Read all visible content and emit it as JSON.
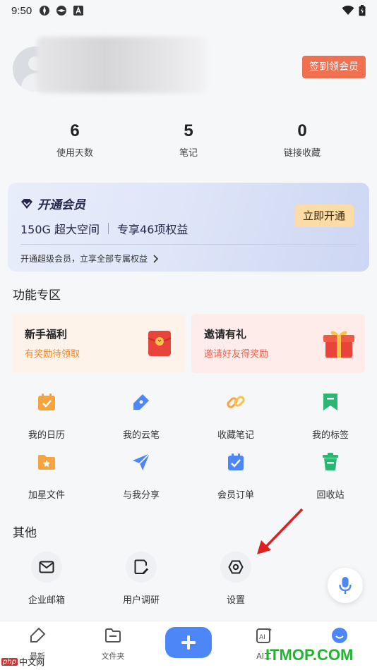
{
  "status_bar": {
    "time": "9:50"
  },
  "profile": {
    "signin_button": "签到领会员"
  },
  "stats": [
    {
      "value": "6",
      "label": "使用天数"
    },
    {
      "value": "5",
      "label": "笔记"
    },
    {
      "value": "0",
      "label": "链接收藏"
    }
  ],
  "vip": {
    "title": "开通会员",
    "storage": "150G 超大空间",
    "benefits": "专享46项权益",
    "button": "立即开通",
    "footer": "开通超级会员，立享全部专属权益"
  },
  "features": {
    "title": "功能专区",
    "promos": [
      {
        "title": "新手福利",
        "subtitle": "有奖励待领取"
      },
      {
        "title": "邀请有礼",
        "subtitle": "邀请好友得奖励"
      }
    ],
    "grid": [
      {
        "label": "我的日历",
        "icon": "calendar-icon",
        "color": "#f7a440"
      },
      {
        "label": "我的云笔",
        "icon": "pen-icon",
        "color": "#4d86f7"
      },
      {
        "label": "收藏笔记",
        "icon": "link-icon",
        "color": "#f7a440"
      },
      {
        "label": "我的标签",
        "icon": "bookmark-icon",
        "color": "#2bb673"
      },
      {
        "label": "加星文件",
        "icon": "star-folder-icon",
        "color": "#f7a440"
      },
      {
        "label": "与我分享",
        "icon": "send-icon",
        "color": "#4d86f7"
      },
      {
        "label": "会员订单",
        "icon": "order-icon",
        "color": "#4d86f7"
      },
      {
        "label": "回收站",
        "icon": "trash-icon",
        "color": "#2bb673"
      }
    ]
  },
  "other": {
    "title": "其他",
    "items": [
      {
        "label": "企业邮箱",
        "icon": "mail-icon"
      },
      {
        "label": "用户调研",
        "icon": "survey-icon"
      },
      {
        "label": "设置",
        "icon": "settings-icon"
      }
    ]
  },
  "tabbar": [
    {
      "label": "最新",
      "icon": "latest-icon"
    },
    {
      "label": "文件夹",
      "icon": "folder-icon"
    },
    {
      "label": "AI工",
      "icon": "ai-icon"
    },
    {
      "label": "",
      "icon": "profile-icon"
    }
  ],
  "watermark": {
    "text": "ITMOP.COM",
    "badge": "php",
    "site": "中文网"
  },
  "colors": {
    "accent": "#4d86f7",
    "signin": "#f07052",
    "vip_button": "#fbdba6"
  }
}
